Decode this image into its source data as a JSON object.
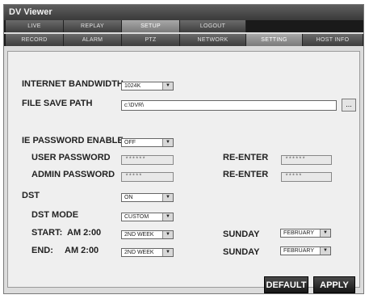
{
  "window": {
    "title": "DV Viewer"
  },
  "main_tabs": [
    {
      "label": "LIVE"
    },
    {
      "label": "REPLAY"
    },
    {
      "label": "SETUP"
    },
    {
      "label": "LOGOUT"
    }
  ],
  "sub_tabs": [
    {
      "label": "RECORD"
    },
    {
      "label": "ALARM"
    },
    {
      "label": "PTZ"
    },
    {
      "label": "NETWORK"
    },
    {
      "label": "SETTING"
    },
    {
      "label": "HOST INFO"
    }
  ],
  "settings": {
    "internet_bandwidth_label": "INTERNET BANDWIDTH",
    "internet_bandwidth_value": "1024K",
    "file_save_path_label": "FILE SAVE PATH",
    "file_save_path_value": "c:\\DVR\\",
    "browse_label": "...",
    "ie_password_enable_label": "IE PASSWORD ENABLE",
    "ie_password_enable_value": "OFF",
    "user_password_label": "USER PASSWORD",
    "user_password_value": "******",
    "user_reenter_label": "RE-ENTER",
    "user_reenter_value": "******",
    "admin_password_label": "ADMIN PASSWORD",
    "admin_password_value": "*****",
    "admin_reenter_label": "RE-ENTER",
    "admin_reenter_value": "*****",
    "dst_label": "DST",
    "dst_value": "ON",
    "dst_mode_label": "DST MODE",
    "dst_mode_value": "CUSTOM",
    "start_label": "START:",
    "start_time": "AM 2:00",
    "start_week_value": "2ND WEEK",
    "start_day": "SUNDAY",
    "start_month_value": "FEBRUARY",
    "end_label": "END:",
    "end_time": "AM 2:00",
    "end_week_value": "2ND WEEK",
    "end_day": "SUNDAY",
    "end_month_value": "FEBRUARY"
  },
  "buttons": {
    "default_label": "DEFAULT",
    "apply_label": "APPLY"
  },
  "dropdown_arrow": "▼"
}
